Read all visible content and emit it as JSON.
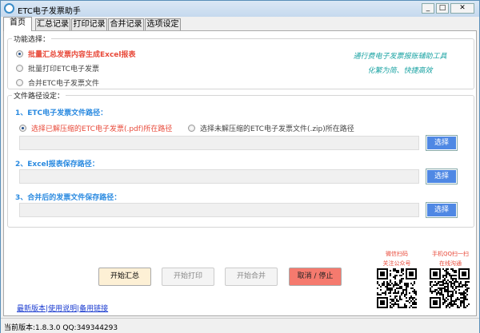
{
  "window": {
    "title": "ETC电子发票助手",
    "min": "_",
    "max": "□",
    "close": "✕"
  },
  "tabs": [
    "首页",
    "汇总记录",
    "打印记录",
    "合并记录",
    "选项设定"
  ],
  "function_group": {
    "title": "功能选择：",
    "options": [
      "批量汇总发票内容生成Excel报表",
      "批量打印ETC电子发票",
      "合并ETC电子发票文件"
    ],
    "selected": 0
  },
  "slogan": [
    "通行费电子发票报账辅助工具",
    "化繁为简、快捷高效"
  ],
  "path_group": {
    "title": "文件路径设定：",
    "etc_label": "1、ETC电子发票文件路径：",
    "etc_options": [
      "选择已解压缩的ETC电子发票(.pdf)所在路径",
      "选择未解压缩的ETC电子发票文件(.zip)所在路径"
    ],
    "excel_label": "2、Excel报表保存路径：",
    "merge_label": "3、合并后的发票文件保存路径：",
    "choose": "选择",
    "etc_path": "",
    "excel_path": "",
    "merge_path": ""
  },
  "actions": {
    "summary": "开始汇总",
    "print": "开始打印",
    "merge": "开始合并",
    "cancel": "取消 / 停止"
  },
  "links": {
    "latest": "最新版本",
    "help": "使用说明",
    "backup": "备用链接",
    "sep": "|"
  },
  "qr": {
    "wechat": [
      "微信扫码",
      "关注公众号"
    ],
    "qq": [
      "手机QQ扫一扫",
      "在线沟通"
    ]
  },
  "status": "当前版本:1.8.3.0  QQ:349344293",
  "colors": {
    "accent": "#4f88e4",
    "highlight": "#e84a3a",
    "cancel": "#f57a6e",
    "summary": "#fdf0d5",
    "slogan": "#1aa3a3"
  }
}
